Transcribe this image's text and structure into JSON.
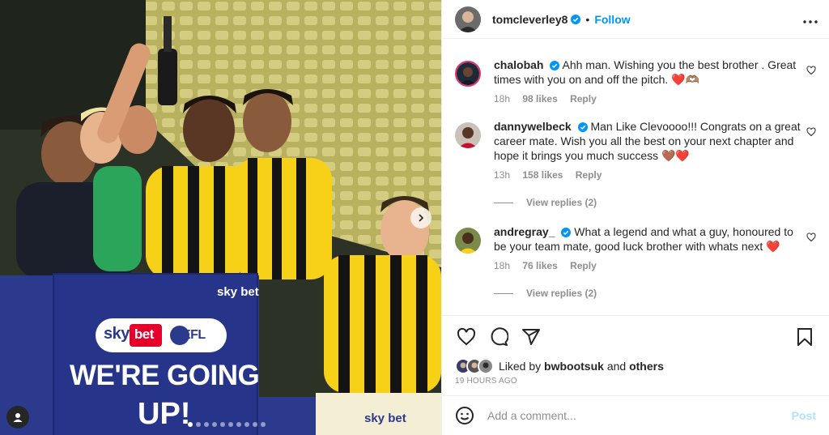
{
  "post": {
    "author": "tomcleverley8",
    "follow_label": "Follow",
    "separator": "•",
    "more_label": "•••"
  },
  "photo": {
    "banner_text_1": "WE'RE GOING",
    "banner_text_2": "UP!",
    "banner_brand_sky": "sky",
    "banner_brand_bet": "bet",
    "banner_brand_efl": "EFL",
    "sponsor_1": "sky bet",
    "sponsor_2": "sky bet",
    "carousel_count": 10,
    "carousel_active": 1
  },
  "comments": [
    {
      "user": "chalobah",
      "text": "Ahh man. Wishing you the best brother . Great times with you on and off the pitch. ❤️🫶🏽",
      "time": "18h",
      "likes": "98 likes",
      "reply_label": "Reply",
      "view_replies": ""
    },
    {
      "user": "dannywelbeck",
      "text": "Man Like Clevoooo!!! Congrats on a great career mate. Wish you all the best on your next chapter and hope it brings you much success 🤎❤️",
      "time": "13h",
      "likes": "158 likes",
      "reply_label": "Reply",
      "view_replies": "View replies (2)"
    },
    {
      "user": "andregray_",
      "text": "What a legend and what a guy, honoured to be your team mate, good luck brother with whats next ❤️",
      "time": "18h",
      "likes": "76 likes",
      "reply_label": "Reply",
      "view_replies": "View replies (2)"
    }
  ],
  "likes": {
    "prefix": "Liked by",
    "user": "bwbootsuk",
    "and_label": "and",
    "others": "others"
  },
  "time_ago": "19 HOURS AGO",
  "add_comment": {
    "placeholder": "Add a comment...",
    "post_label": "Post"
  },
  "colors": {
    "accent": "#0095f6",
    "post_disabled": "#b2dffc",
    "like_red": "#ed4956",
    "watford_yellow": "#f7d117"
  }
}
